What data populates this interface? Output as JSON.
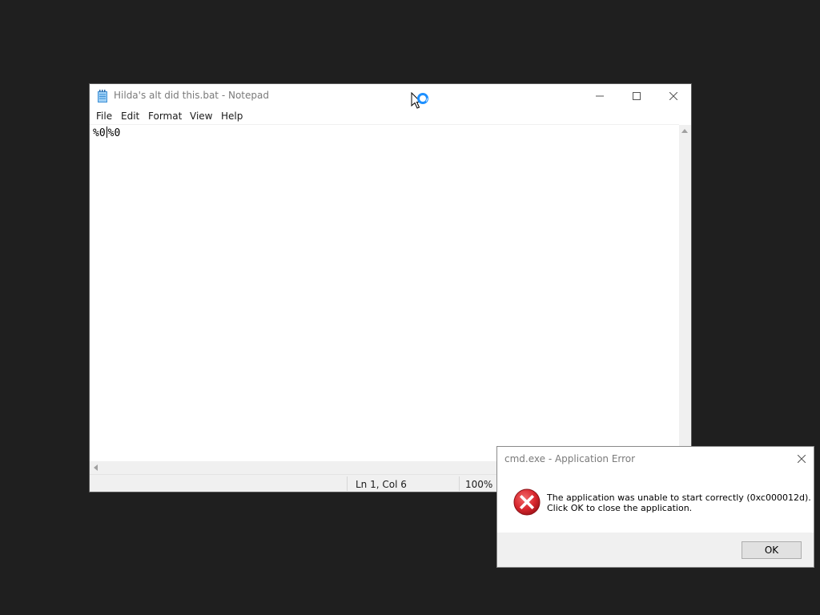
{
  "notepad": {
    "title": "Hilda's alt did this.bat - Notepad",
    "menu": [
      {
        "label": "File"
      },
      {
        "label": "Edit"
      },
      {
        "label": "Format"
      },
      {
        "label": "View"
      },
      {
        "label": "Help"
      }
    ],
    "content_before_caret": "%0",
    "content_after_caret": "%0",
    "status": {
      "position": "Ln 1, Col 6",
      "zoom": "100%"
    },
    "icons": {
      "app": "notepad-icon",
      "minimize": "minimize-icon",
      "maximize": "maximize-icon",
      "close": "close-icon"
    }
  },
  "cursor": {
    "icon": "busy-pointer-icon",
    "accent": "#1e90ff"
  },
  "dialog": {
    "title": "cmd.exe - Application Error",
    "message_line1": "The application was unable to start correctly (0xc000012d).",
    "message_line2": "Click OK to close the application.",
    "ok_label": "OK",
    "icon": "error-icon",
    "icon_color": "#d9272e"
  }
}
